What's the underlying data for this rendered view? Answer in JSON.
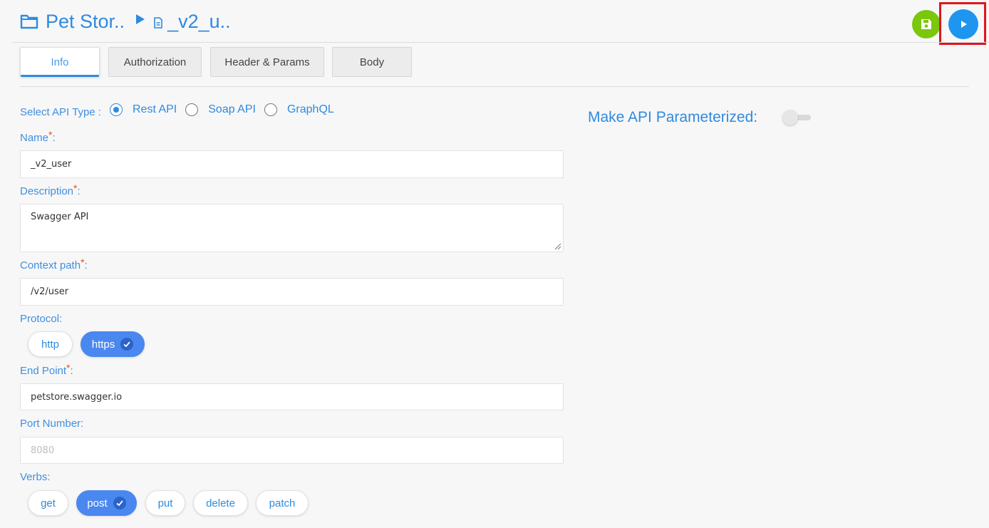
{
  "header": {
    "collection_name": "Pet Stor..",
    "api_name": "_v2_u.."
  },
  "tabs": [
    {
      "label": "Info",
      "active": true
    },
    {
      "label": "Authorization",
      "active": false
    },
    {
      "label": "Header & Params",
      "active": false
    },
    {
      "label": "Body",
      "active": false
    }
  ],
  "form": {
    "api_type_label": "Select API Type :",
    "api_types": [
      {
        "label": "Rest API",
        "selected": true
      },
      {
        "label": "Soap API",
        "selected": false
      },
      {
        "label": "GraphQL",
        "selected": false
      }
    ],
    "name_label": "Name",
    "name_value": "_v2_user",
    "description_label": "Description",
    "description_value": "Swagger API",
    "context_label": "Context path",
    "context_value": "/v2/user",
    "protocol_label": "Protocol:",
    "protocols": [
      {
        "label": "http",
        "selected": false
      },
      {
        "label": "https",
        "selected": true
      }
    ],
    "endpoint_label": "End Point",
    "endpoint_value": "petstore.swagger.io",
    "port_label": "Port Number:",
    "port_placeholder": "8080",
    "verbs_label": "Verbs:",
    "verbs": [
      {
        "label": "get",
        "selected": false
      },
      {
        "label": "post",
        "selected": true
      },
      {
        "label": "put",
        "selected": false
      },
      {
        "label": "delete",
        "selected": false
      },
      {
        "label": "patch",
        "selected": false
      }
    ],
    "required_marker": "*",
    "colon": ":"
  },
  "parameterize": {
    "label": "Make API Parameterized:",
    "enabled": false
  },
  "colors": {
    "accent": "#2f8ae0",
    "save": "#7ac70c",
    "run": "#1e96f0",
    "highlight": "#e0161d",
    "required": "#e3541b"
  },
  "icons": {
    "folder": "folder-icon",
    "breadcrumb_arrow": "caret-right-icon",
    "file": "file-icon",
    "save": "floppy-disk-icon",
    "run": "play-icon",
    "check": "check-icon"
  }
}
